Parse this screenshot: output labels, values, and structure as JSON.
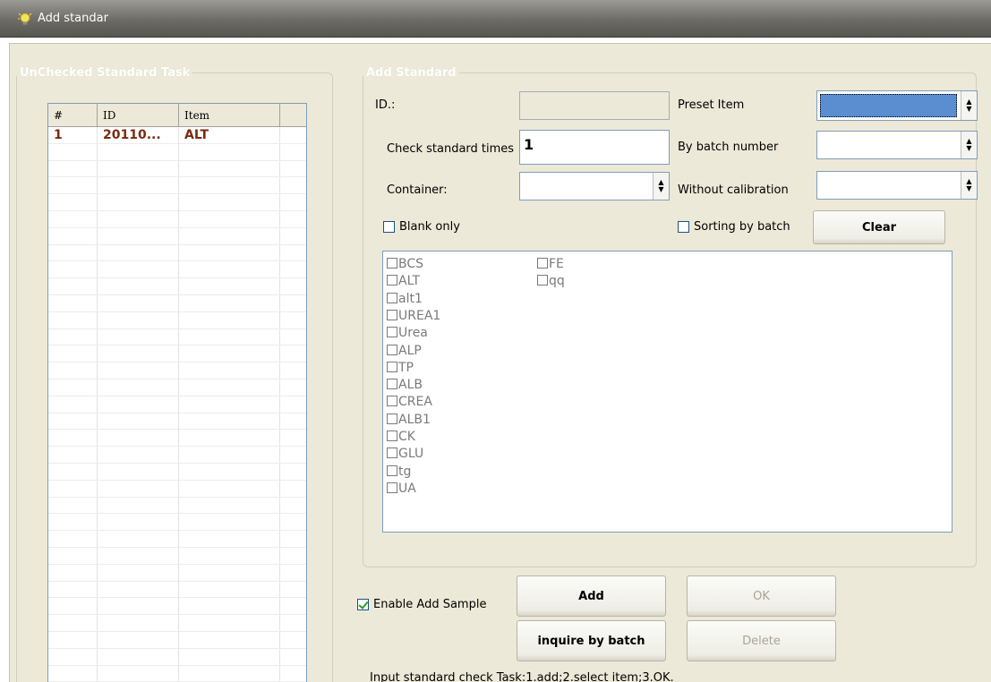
{
  "window": {
    "title": "Add standar"
  },
  "left_group": {
    "legend": "UnChecked Standard Task",
    "columns": [
      "#",
      "ID",
      "Item",
      ""
    ],
    "rows": [
      [
        "1",
        "20110...",
        "ALT",
        ""
      ]
    ],
    "empty_rows": 33
  },
  "right_group": {
    "legend": "Add Standard",
    "id_label": "ID.:",
    "id_value": "",
    "check_times_label": "Check standard times",
    "check_times_value": "1",
    "container_label": "Container:",
    "container_value": "",
    "preset_label": "Preset Item",
    "preset_value": "",
    "batch_number_label": "By batch number",
    "batch_number_value": "",
    "without_calibration_label": "Without calibration",
    "without_calibration_value": "",
    "blank_only_label": "Blank only",
    "blank_only_checked": false,
    "sorting_label": "Sorting by batch",
    "sorting_checked": false,
    "clear_label": "Clear",
    "items_col1": [
      "BCS",
      "ALT",
      "alt1",
      "UREA1",
      "Urea",
      "ALP",
      "TP",
      "ALB",
      "CREA",
      "ALB1",
      "CK",
      "GLU",
      "tg",
      "UA"
    ],
    "items_col2": [
      "FE",
      "qq"
    ]
  },
  "bottom": {
    "enable_add_label": "Enable Add Sample",
    "enable_add_checked": true,
    "add_label": "Add",
    "inquire_label": "inquire by batch",
    "ok_label": "OK",
    "delete_label": "Delete",
    "status": "Input standard check Task:1.add;2.select item;3.OK."
  },
  "colors": {
    "title_bar": "#6d6b66",
    "dialog_bg": "#ece9d8",
    "row_text": "#7a2b0d",
    "selected_combo": "#5a8ed0",
    "check_mark": "#21a121"
  },
  "icons": {
    "app": "lightbulb-icon",
    "spin": "spin-arrows-icon"
  }
}
